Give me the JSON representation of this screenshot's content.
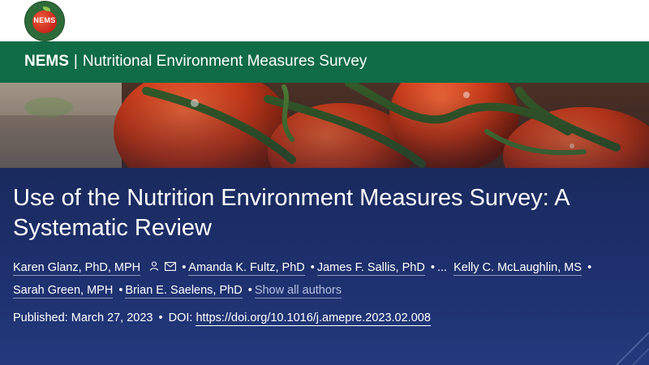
{
  "site": {
    "logo_text": "NEMS",
    "brand_short": "NEMS",
    "brand_separator": "|",
    "brand_full": "Nutritional Environment Measures Survey"
  },
  "article": {
    "title": "Use of the Nutrition Environment Measures Survey: A Systematic Review",
    "authors_line1": [
      "Karen Glanz, PhD, MPH",
      "Amanda K. Fultz, PhD",
      "James F. Sallis, PhD",
      "...",
      "Kelly C. McLaughlin, MS"
    ],
    "authors_line2": [
      "Sarah Green, MPH",
      "Brian E. Saelens, PhD"
    ],
    "show_all": "Show all authors",
    "bullet": "•",
    "published_label": "Published: March 27, 2023",
    "doi_label": "DOI:",
    "doi_link": "https://doi.org/10.1016/j.amepre.2023.02.008"
  },
  "colors": {
    "banner": "#0f6c46",
    "content_bg": "#1d2f66",
    "link_muted": "#b9c1e0"
  },
  "icons": [
    "person-icon",
    "mail-icon"
  ]
}
